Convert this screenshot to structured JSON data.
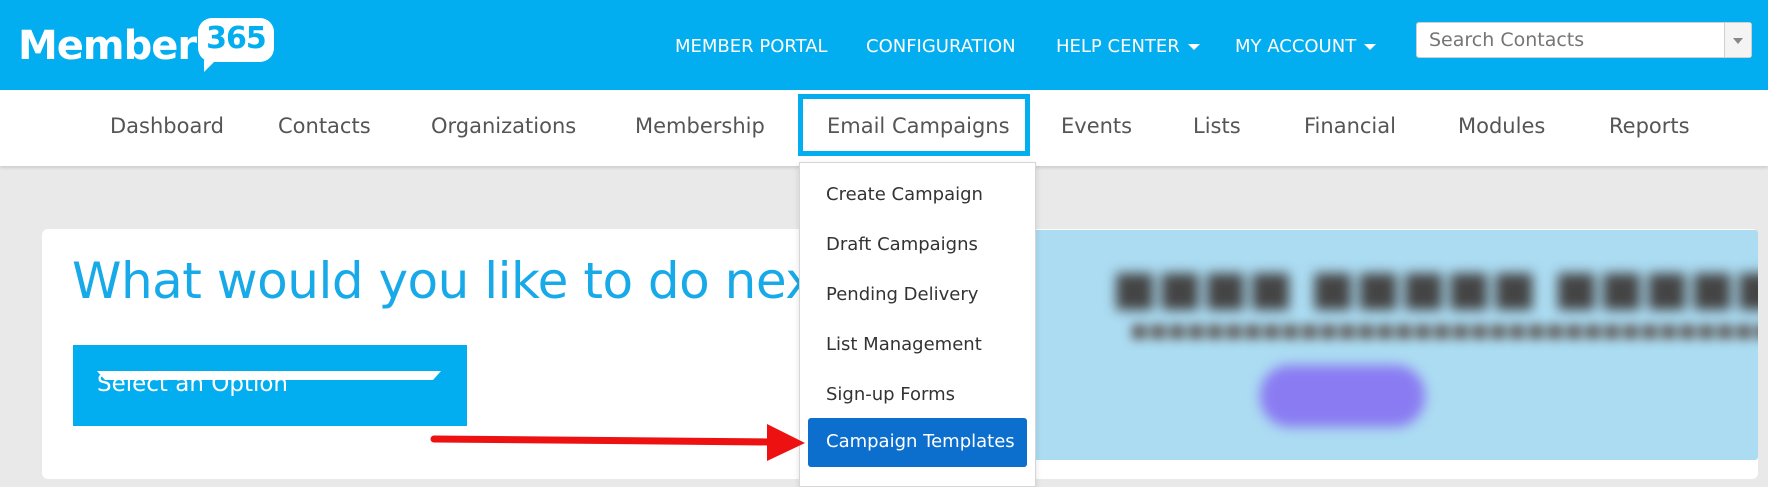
{
  "header": {
    "logo_text": "Member",
    "logo_badge": "365",
    "nav": [
      "MEMBER PORTAL",
      "CONFIGURATION",
      "HELP CENTER",
      "MY ACCOUNT"
    ],
    "search_placeholder": "Search Contacts"
  },
  "main_nav": {
    "items": [
      "Dashboard",
      "Contacts",
      "Organizations",
      "Membership",
      "Email Campaigns",
      "Events",
      "Lists",
      "Financial",
      "Modules",
      "Reports"
    ],
    "active": "Email Campaigns"
  },
  "dropdown": {
    "items": [
      "Create Campaign",
      "Draft Campaigns",
      "Pending Delivery",
      "List Management",
      "Sign-up Forms",
      "Campaign Templates"
    ],
    "highlighted": "Campaign Templates"
  },
  "content": {
    "heading": "What would you like to do next?",
    "select_label": "Select an Option"
  },
  "colors": {
    "brand": "#03aef0",
    "highlight": "#0c6fce",
    "arrow": "#ee1111"
  },
  "icons": [
    "chevron-down-icon",
    "dropdown-caret-icon",
    "red-arrow-annotation"
  ]
}
